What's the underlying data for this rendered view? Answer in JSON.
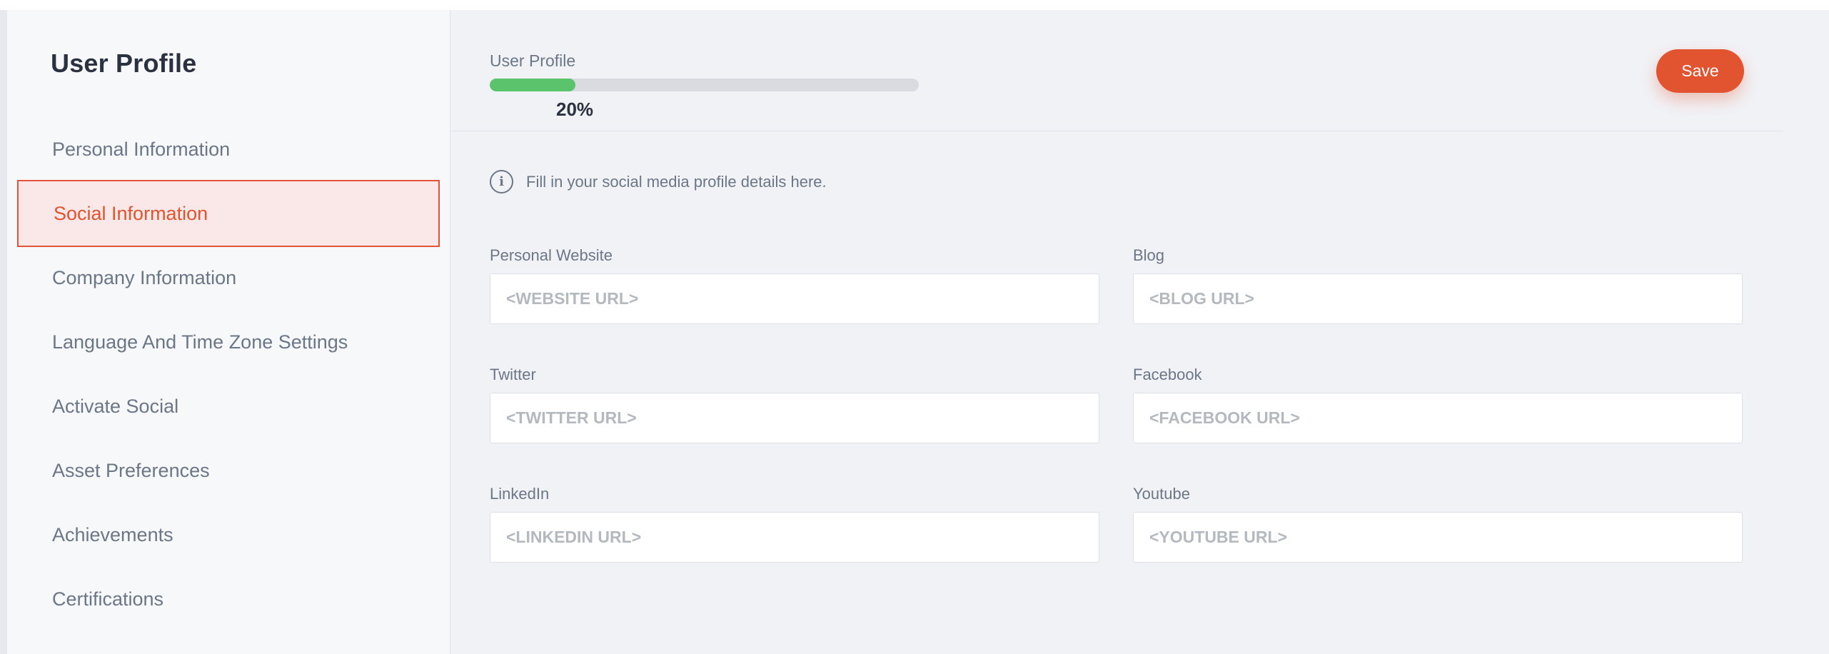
{
  "sidebar": {
    "title": "User Profile",
    "items": [
      {
        "label": "Personal Information",
        "active": false
      },
      {
        "label": "Social Information",
        "active": true
      },
      {
        "label": "Company Information",
        "active": false
      },
      {
        "label": "Language And Time Zone Settings",
        "active": false
      },
      {
        "label": "Activate Social",
        "active": false
      },
      {
        "label": "Asset Preferences",
        "active": false
      },
      {
        "label": "Achievements",
        "active": false
      },
      {
        "label": "Certifications",
        "active": false
      }
    ]
  },
  "header": {
    "progress_label": "User Profile",
    "progress_percent": 20,
    "progress_text": "20%",
    "save_label": "Save"
  },
  "info": {
    "icon": "info-icon",
    "text": "Fill in your social media profile details here."
  },
  "fields": {
    "personal_website": {
      "label": "Personal Website",
      "value": "",
      "placeholder": "<WEBSITE URL>"
    },
    "blog": {
      "label": "Blog",
      "value": "",
      "placeholder": "<BLOG URL>"
    },
    "twitter": {
      "label": "Twitter",
      "value": "",
      "placeholder": "<TWITTER URL>"
    },
    "facebook": {
      "label": "Facebook",
      "value": "",
      "placeholder": "<FACEBOOK URL>"
    },
    "linkedin": {
      "label": "LinkedIn",
      "value": "",
      "placeholder": "<LINKEDIN URL>"
    },
    "youtube": {
      "label": "Youtube",
      "value": "",
      "placeholder": "<YOUTUBE URL>"
    }
  },
  "colors": {
    "accent": "#e2532f",
    "active_bg": "#f9e8e7",
    "progress": "#5ac36b"
  }
}
